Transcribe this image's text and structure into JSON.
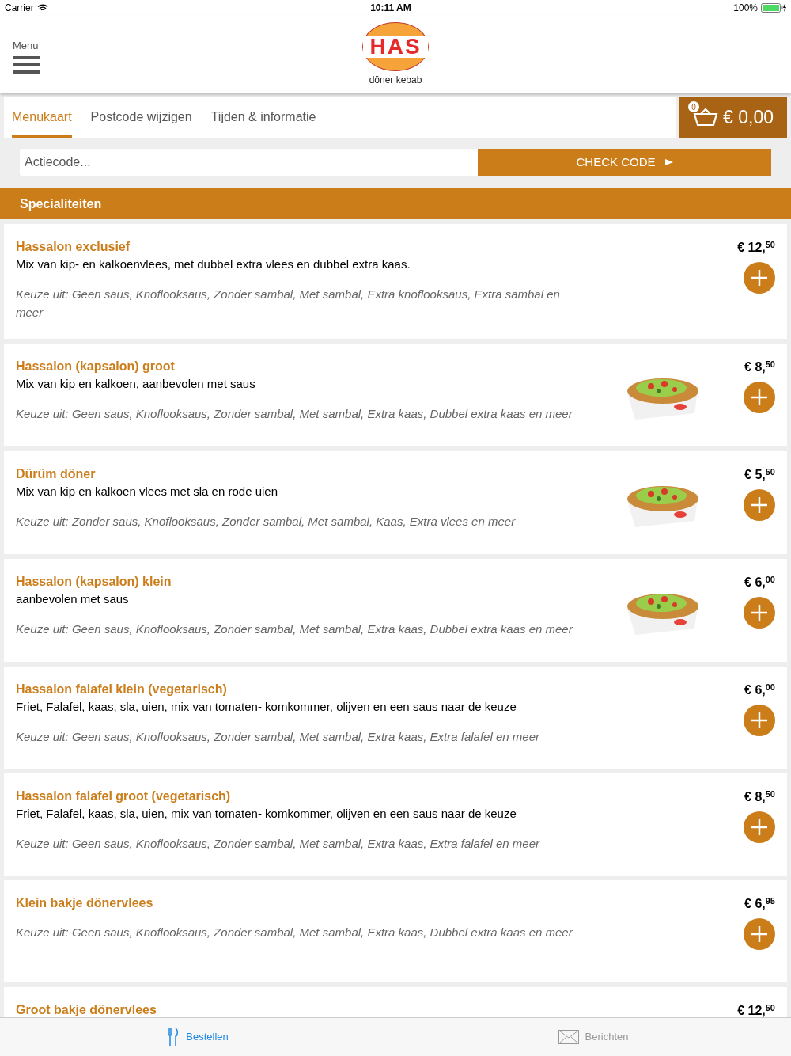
{
  "status_bar": {
    "carrier": "Carrier",
    "time": "10:11 AM",
    "battery": "100%"
  },
  "header": {
    "menu_label": "Menu",
    "logo_text": "HAS",
    "logo_subtitle": "döner kebab"
  },
  "tabs": [
    {
      "label": "Menukaart",
      "selected": true
    },
    {
      "label": "Postcode wijzigen",
      "selected": false
    },
    {
      "label": "Tijden & informatie",
      "selected": false
    }
  ],
  "cart": {
    "count": "0",
    "total": "€ 0,00"
  },
  "promo": {
    "placeholder": "Actiecode...",
    "button": "CHECK CODE"
  },
  "category": "Specialiteiten",
  "items": [
    {
      "name": "Hassalon exclusief",
      "description": "Mix van kip- en kalkoenvlees, met dubbel extra vlees en dubbel extra kaas.",
      "options": "Keuze uit: Geen saus, Knoflooksaus, Zonder sambal, Met sambal, Extra knoflooksaus, Extra sambal en meer",
      "price": "€ 12,$^{50}$",
      "picture": false
    },
    {
      "name": "Hassalon (kapsalon) groot",
      "description": "Mix van kip en kalkoen, aanbevolen met saus",
      "options": "Keuze uit: Geen saus, Knoflooksaus, Zonder sambal, Met sambal, Extra kaas, Dubbel extra kaas en meer",
      "price": "€ 8,$^{50}$",
      "picture": true
    },
    {
      "name": "Dürüm döner",
      "description": "Mix van kip en kalkoen vlees met sla en rode uien",
      "options": "Keuze uit: Zonder saus, Knoflooksaus, Zonder sambal, Met sambal, Kaas, Extra vlees en meer",
      "price": "€ 5,$^{50}$",
      "picture": true
    },
    {
      "name": "Hassalon (kapsalon) klein",
      "description": "aanbevolen met saus",
      "options": "Keuze uit: Geen saus, Knoflooksaus, Zonder sambal, Met sambal, Extra kaas, Dubbel extra kaas en meer",
      "price": "€ 6,$^{00}$",
      "picture": true
    },
    {
      "name": "Hassalon falafel klein (vegetarisch)",
      "description": "Friet, Falafel, kaas, sla, uien, mix van tomaten- komkommer, olijven en een saus naar de keuze",
      "options": "Keuze uit: Geen saus, Knoflooksaus, Zonder sambal, Met sambal, Extra kaas, Extra falafel en meer",
      "price": "€ 6,$^{00}$",
      "picture": false
    },
    {
      "name": "Hassalon falafel groot (vegetarisch)",
      "description": "Friet, Falafel, kaas, sla, uien, mix van tomaten- komkommer, olijven en een saus naar de keuze",
      "options": "Keuze uit: Geen saus, Knoflooksaus, Zonder sambal, Met sambal, Extra kaas, Extra falafel en meer",
      "price": "€ 8,$^{50}$",
      "picture": false
    },
    {
      "name": "Klein bakje dönervlees",
      "options": "Keuze uit: Geen saus, Knoflooksaus, Zonder sambal, Met sambal, Extra kaas, Dubbel extra kaas en meer",
      "price": "€ 6,$^{95}$",
      "picture": false
    },
    {
      "name": "Groot bakje dönervlees",
      "price": "€ 12,$^{50}$"
    }
  ],
  "bottom_tabs": [
    {
      "label": "Bestellen",
      "selected": true
    },
    {
      "label": "Berichten",
      "selected": false
    }
  ]
}
